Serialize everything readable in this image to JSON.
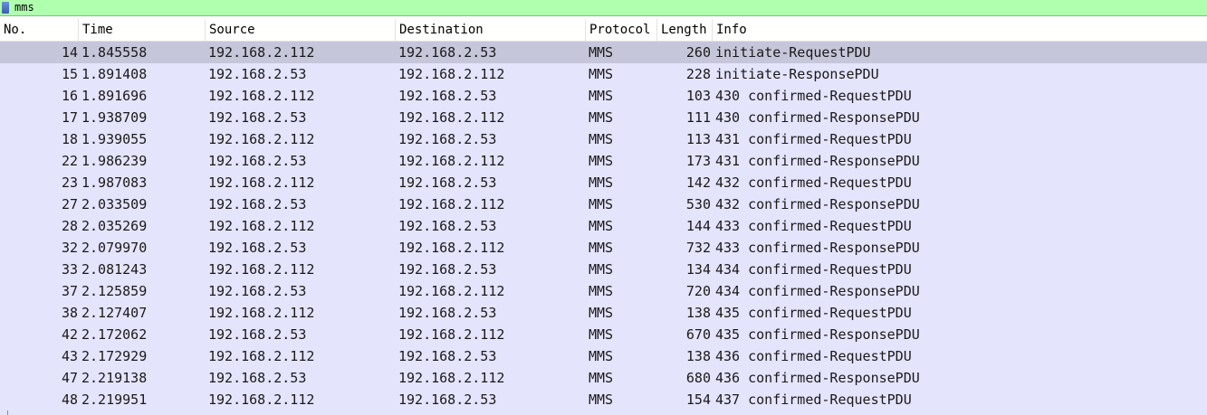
{
  "filter": {
    "value": "mms"
  },
  "columns": {
    "no": "No.",
    "time": "Time",
    "source": "Source",
    "destination": "Destination",
    "protocol": "Protocol",
    "length": "Length",
    "info": "Info"
  },
  "packets": [
    {
      "no": "14",
      "time": "1.845558",
      "source": "192.168.2.112",
      "destination": "192.168.2.53",
      "protocol": "MMS",
      "length": "260",
      "info": "initiate-RequestPDU"
    },
    {
      "no": "15",
      "time": "1.891408",
      "source": "192.168.2.53",
      "destination": "192.168.2.112",
      "protocol": "MMS",
      "length": "228",
      "info": "initiate-ResponsePDU"
    },
    {
      "no": "16",
      "time": "1.891696",
      "source": "192.168.2.112",
      "destination": "192.168.2.53",
      "protocol": "MMS",
      "length": "103",
      "info": "430 confirmed-RequestPDU"
    },
    {
      "no": "17",
      "time": "1.938709",
      "source": "192.168.2.53",
      "destination": "192.168.2.112",
      "protocol": "MMS",
      "length": "111",
      "info": "430 confirmed-ResponsePDU"
    },
    {
      "no": "18",
      "time": "1.939055",
      "source": "192.168.2.112",
      "destination": "192.168.2.53",
      "protocol": "MMS",
      "length": "113",
      "info": "431 confirmed-RequestPDU"
    },
    {
      "no": "22",
      "time": "1.986239",
      "source": "192.168.2.53",
      "destination": "192.168.2.112",
      "protocol": "MMS",
      "length": "173",
      "info": "431 confirmed-ResponsePDU"
    },
    {
      "no": "23",
      "time": "1.987083",
      "source": "192.168.2.112",
      "destination": "192.168.2.53",
      "protocol": "MMS",
      "length": "142",
      "info": "432 confirmed-RequestPDU"
    },
    {
      "no": "27",
      "time": "2.033509",
      "source": "192.168.2.53",
      "destination": "192.168.2.112",
      "protocol": "MMS",
      "length": "530",
      "info": "432 confirmed-ResponsePDU"
    },
    {
      "no": "28",
      "time": "2.035269",
      "source": "192.168.2.112",
      "destination": "192.168.2.53",
      "protocol": "MMS",
      "length": "144",
      "info": "433 confirmed-RequestPDU"
    },
    {
      "no": "32",
      "time": "2.079970",
      "source": "192.168.2.53",
      "destination": "192.168.2.112",
      "protocol": "MMS",
      "length": "732",
      "info": "433 confirmed-ResponsePDU"
    },
    {
      "no": "33",
      "time": "2.081243",
      "source": "192.168.2.112",
      "destination": "192.168.2.53",
      "protocol": "MMS",
      "length": "134",
      "info": "434 confirmed-RequestPDU"
    },
    {
      "no": "37",
      "time": "2.125859",
      "source": "192.168.2.53",
      "destination": "192.168.2.112",
      "protocol": "MMS",
      "length": "720",
      "info": "434 confirmed-ResponsePDU"
    },
    {
      "no": "38",
      "time": "2.127407",
      "source": "192.168.2.112",
      "destination": "192.168.2.53",
      "protocol": "MMS",
      "length": "138",
      "info": "435 confirmed-RequestPDU"
    },
    {
      "no": "42",
      "time": "2.172062",
      "source": "192.168.2.53",
      "destination": "192.168.2.112",
      "protocol": "MMS",
      "length": "670",
      "info": "435 confirmed-ResponsePDU"
    },
    {
      "no": "43",
      "time": "2.172929",
      "source": "192.168.2.112",
      "destination": "192.168.2.53",
      "protocol": "MMS",
      "length": "138",
      "info": "436 confirmed-RequestPDU"
    },
    {
      "no": "47",
      "time": "2.219138",
      "source": "192.168.2.53",
      "destination": "192.168.2.112",
      "protocol": "MMS",
      "length": "680",
      "info": "436 confirmed-ResponsePDU"
    },
    {
      "no": "48",
      "time": "2.219951",
      "source": "192.168.2.112",
      "destination": "192.168.2.53",
      "protocol": "MMS",
      "length": "154",
      "info": "437 confirmed-RequestPDU"
    }
  ],
  "selected_index": 0,
  "colors": {
    "filter_valid": "#afffaf",
    "row_background": "#e4e4fc",
    "row_selected": "#c6c6da"
  },
  "icons": {
    "filter_bookmark": "bookmark-icon"
  }
}
